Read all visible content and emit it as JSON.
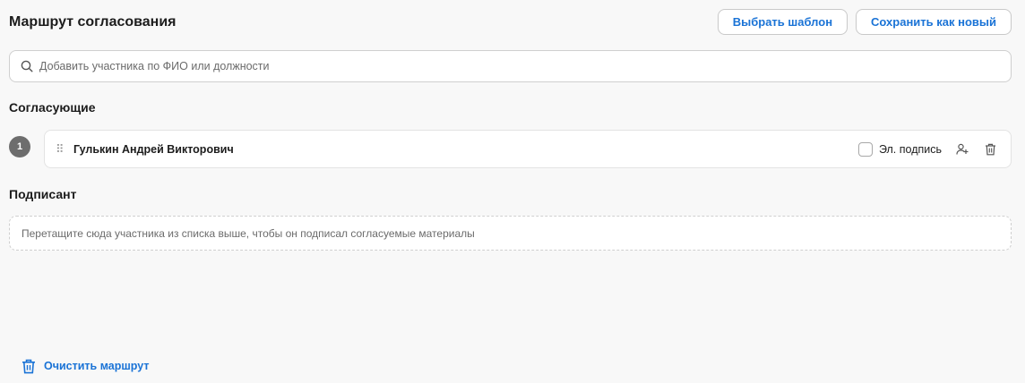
{
  "header": {
    "title": "Маршрут согласования",
    "choose_template_label": "Выбрать шаблон",
    "save_as_new_label": "Сохранить как новый"
  },
  "search": {
    "placeholder": "Добавить участника по ФИО или должности",
    "value": "",
    "icon": "search-icon"
  },
  "approvers": {
    "title": "Согласующие",
    "items": [
      {
        "number": "1",
        "name": "Гулькин Андрей Викторович",
        "esign_label": "Эл. подпись",
        "esign_checked": false
      }
    ]
  },
  "signer": {
    "title": "Подписант",
    "dropzone_text": "Перетащите сюда участника из списка выше, чтобы он подписал согласуемые материалы"
  },
  "footer": {
    "clear_label": "Очистить маршрут"
  },
  "colors": {
    "accent": "#1a73d6",
    "step_badge": "#6d6d6d",
    "background": "#f8f8f8"
  }
}
